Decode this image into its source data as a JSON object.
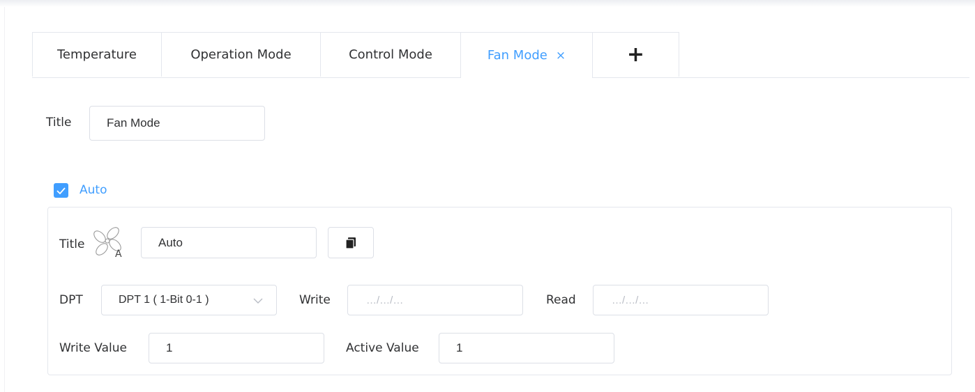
{
  "tabs": [
    {
      "label": "Temperature"
    },
    {
      "label": "Operation Mode"
    },
    {
      "label": "Control Mode"
    },
    {
      "label": "Fan Mode",
      "closable": true,
      "close_symbol": "×",
      "active": true
    }
  ],
  "add_tab": {
    "symbol": "+"
  },
  "title_field": {
    "label": "Title",
    "value": "Fan Mode"
  },
  "mode_item": {
    "checkbox_label": "Auto",
    "checked": true,
    "title_label": "Title",
    "icon": "fan-auto-icon",
    "title_value": "Auto",
    "copy_icon": "copy-icon",
    "dpt_label": "DPT",
    "dpt_value": "DPT 1 ( 1-Bit 0-1 )",
    "write_label": "Write",
    "write_placeholder": "…/…/…",
    "read_label": "Read",
    "read_placeholder": "…/…/…",
    "write_value_label": "Write Value",
    "write_value": "1",
    "active_value_label": "Active Value",
    "active_value": "1"
  },
  "colors": {
    "accent": "#409eff",
    "border": "#dcdfe6",
    "text": "#303133",
    "placeholder": "#b8bcc4"
  }
}
